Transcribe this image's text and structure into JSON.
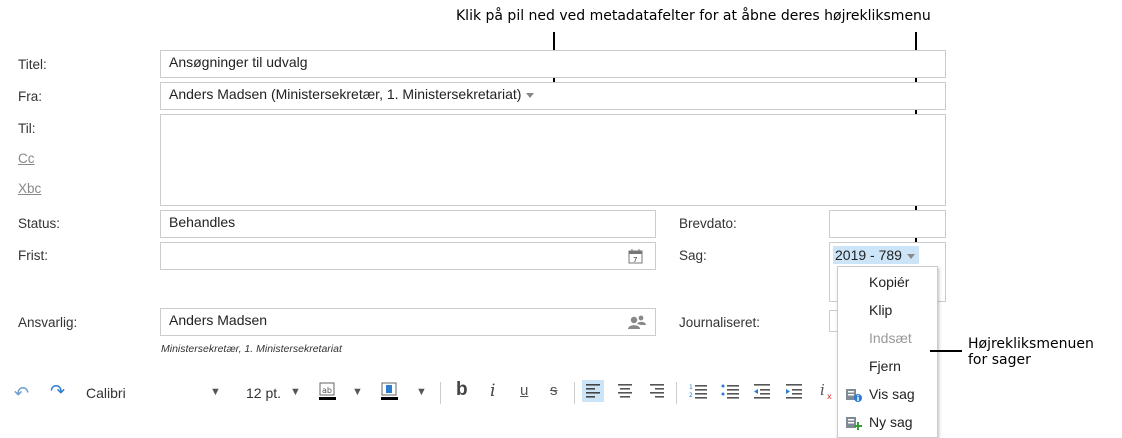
{
  "annotations": {
    "top_text": "Klik på pil ned ved metadatafelter for at åbne deres højrekliksmenu",
    "side_line1": "Højrekliksmenuen",
    "side_line2": "for sager"
  },
  "form": {
    "titel_label": "Titel:",
    "titel_value": "Ansøgninger til udvalg",
    "fra_label": "Fra:",
    "fra_value": "Anders Madsen (Ministersekretær, 1. Ministersekretariat)",
    "til_label": "Til:",
    "cc_label": "Cc",
    "xbc_label": "Xbc",
    "status_label": "Status:",
    "status_value": "Behandles",
    "brevdato_label": "Brevdato:",
    "frist_label": "Frist:",
    "sag_label": "Sag:",
    "sag_value": "2019 - 789",
    "ansvarlig_label": "Ansvarlig:",
    "ansvarlig_value": "Anders Madsen",
    "ansvarlig_sub": "Ministersekretær, 1. Ministersekretariat",
    "journaliseret_label": "Journaliseret:"
  },
  "context_menu": {
    "items": [
      {
        "label": "Kopiér",
        "disabled": false
      },
      {
        "label": "Klip",
        "disabled": false
      },
      {
        "label": "Indsæt",
        "disabled": true
      },
      {
        "label": "Fjern",
        "disabled": false
      },
      {
        "label": "Vis sag",
        "disabled": false
      },
      {
        "label": "Ny sag",
        "disabled": false
      }
    ]
  },
  "toolbar": {
    "font": "Calibri",
    "size": "12 pt.",
    "bold": "b",
    "italic": "i",
    "underline": "u",
    "strike": "s"
  },
  "colors": {
    "accent": "#2b7cd3",
    "selection": "#cce4f7",
    "highlight_underline": "#000000"
  }
}
